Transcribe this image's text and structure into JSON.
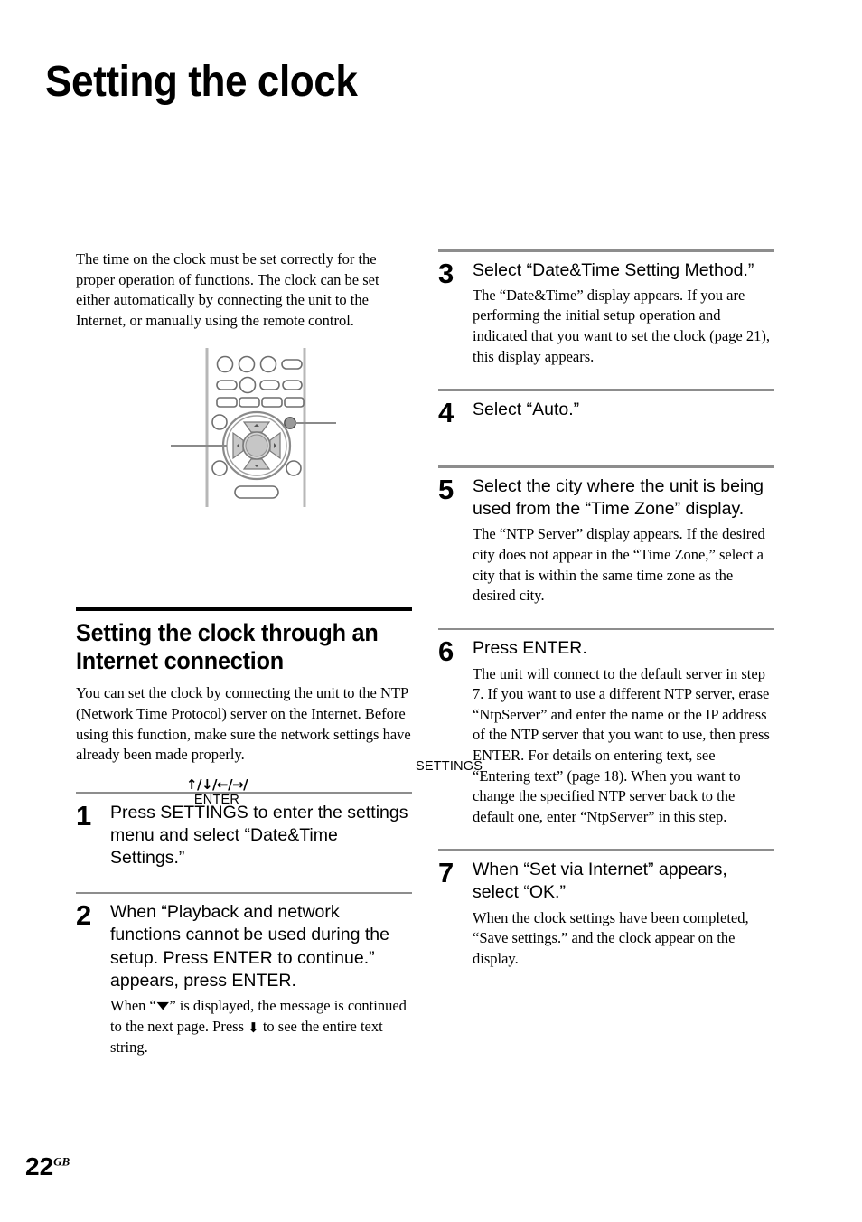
{
  "document": {
    "title": "Setting the clock",
    "folio_number": "22",
    "folio_suffix": "GB"
  },
  "intro": {
    "paragraph": "The time on the clock must be set correctly for the proper operation of functions. The clock can be set either automatically by connecting the unit to the Internet, or manually using the remote control."
  },
  "remote_diagram": {
    "callout_settings": "SETTINGS",
    "callout_nav_glyphs": "↑/↓/←/→/",
    "callout_nav_enter": "ENTER"
  },
  "section": {
    "heading": "Setting the clock through an Internet connection",
    "body": "You can set the clock by connecting the unit to the NTP (Network Time Protocol) server on the Internet. Before using this function, make sure the network settings have already been made properly."
  },
  "steps_left": [
    {
      "number": "1",
      "head": "Press SETTINGS to enter the settings menu and select “Date&Time Settings.”",
      "note": ""
    },
    {
      "number": "2",
      "head": "When “Playback and network functions cannot be used during the setup. Press ENTER to continue.” appears, press ENTER.",
      "note_parts": {
        "a": "When “",
        "arrow1": "▼",
        "b": "” is displayed, the message is continued to the next page. Press ",
        "arrow2": "⬇",
        "c": " to see the entire text string."
      }
    }
  ],
  "steps_right": [
    {
      "number": "3",
      "head": "Select “Date&Time Setting Method.”",
      "note": "The “Date&Time” display appears. If you are performing the initial setup operation and indicated that you want to set the clock (page 21), this display appears."
    },
    {
      "number": "4",
      "head": "Select “Auto.”",
      "note": ""
    },
    {
      "number": "5",
      "head": "Select the city where the unit is being used from the “Time Zone” display.",
      "note": "The “NTP Server” display appears. If the desired city does not appear in the “Time Zone,” select a city that is within the same time zone as the desired city."
    },
    {
      "number": "6",
      "head": "Press ENTER.",
      "note": "The unit will connect to the default server in step 7. If you want to use a different NTP server, erase “NtpServer” and enter the name or the IP address of the NTP server that you want to use, then press ENTER. For details on entering text, see “Entering text” (page 18). When you want to change the specified NTP server back to the default one, enter “NtpServer” in this step."
    },
    {
      "number": "7",
      "head": "When “Set via Internet” appears, select “OK.”",
      "note": "When the clock settings have been completed, “Save settings.” and the clock appear on the display."
    }
  ]
}
